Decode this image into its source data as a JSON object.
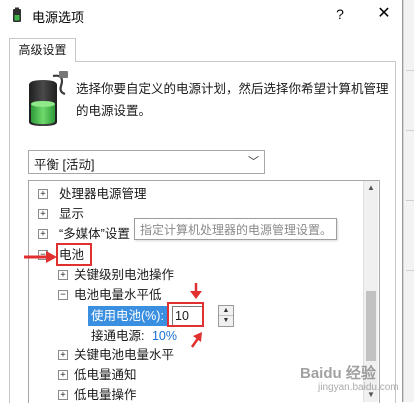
{
  "window": {
    "title": "电源选项",
    "help_glyph": "?",
    "close_glyph": "✕"
  },
  "tabs": [
    {
      "label": "高级设置",
      "selected": true
    }
  ],
  "description": {
    "line1": "选择你要自定义的电源计划，然后选择你希望计算机管理",
    "line2": "的电源设置。"
  },
  "plan_dropdown": {
    "selected": "平衡 [活动]"
  },
  "tree": {
    "items": [
      {
        "label": "处理器电源管理",
        "expander": "+"
      },
      {
        "label": "显示",
        "expander": "+"
      },
      {
        "label": "“多媒体”设置",
        "expander": "+"
      },
      {
        "label": "电池",
        "expander": "−"
      },
      {
        "label": "关键级别电池操作",
        "expander": "+"
      },
      {
        "label": "电池电量水平低",
        "expander": "−"
      },
      {
        "label": "关键电池电量水平",
        "expander": "+"
      },
      {
        "label": "低电量通知",
        "expander": "+"
      },
      {
        "label": "低电量操作",
        "expander": "+"
      }
    ],
    "on_battery": {
      "label": "使用电池(%):",
      "value": "10"
    },
    "plugged_in": {
      "label": "接通电源:",
      "value": "10%"
    },
    "tooltip": "指定计算机处理器的电源管理设置。"
  },
  "watermark": {
    "line1": "Baidu 经验",
    "line2": "jingyan.baidu.com"
  },
  "colors": {
    "selection": "#3b8fe0",
    "annotation": "#e03030",
    "link_value": "#1a6fd1",
    "battery_green": "#3fb24a"
  },
  "icons": [
    "battery-icon",
    "close-icon",
    "help-icon",
    "chevron-down-icon",
    "expand-icon",
    "collapse-icon",
    "arrow-up-icon",
    "arrow-down-icon"
  ]
}
